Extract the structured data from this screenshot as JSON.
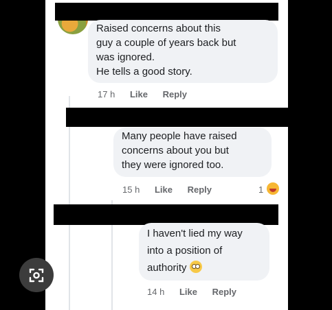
{
  "comments": [
    {
      "lines": [
        "Raised concerns about this",
        "guy a couple of years back but",
        "was ignored.",
        "He tells a good story."
      ],
      "time": "17 h",
      "like": "Like",
      "reply": "Reply"
    },
    {
      "lines": [
        "Many people have raised",
        "concerns about you but",
        "they were ignored too."
      ],
      "time": "15 h",
      "like": "Like",
      "reply": "Reply",
      "reaction_count": "1",
      "reaction_icon": "laughing-emoji-icon"
    },
    {
      "lines": [
        "I haven't lied my way",
        "into a position of",
        "authority"
      ],
      "trailing_emoji": "flushed-emoji-icon",
      "time": "14 h",
      "like": "Like",
      "reply": "Reply"
    }
  ],
  "overlay": {
    "icon": "lens-search-icon"
  },
  "colors": {
    "bubble": "#f0f2f5",
    "text": "#1c1e21",
    "meta": "#65676b",
    "background": "#000000"
  }
}
